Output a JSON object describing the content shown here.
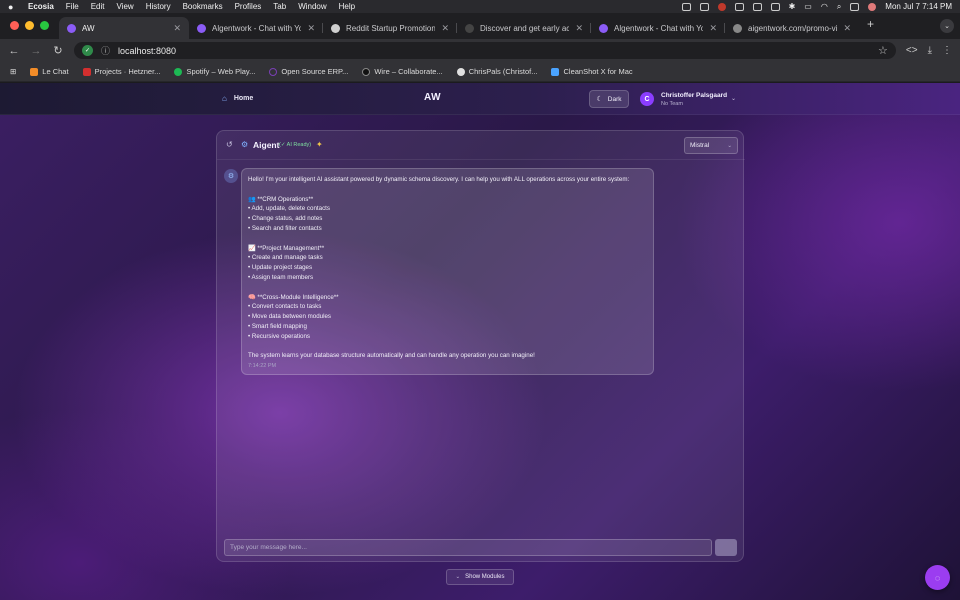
{
  "menubar": {
    "app": "Ecosia",
    "items": [
      "File",
      "Edit",
      "View",
      "History",
      "Bookmarks",
      "Profiles",
      "Tab",
      "Window",
      "Help"
    ],
    "clock": "Mon Jul 7  7:14 PM"
  },
  "tabs": [
    {
      "title": "AW",
      "active": true,
      "favicon_color": "#8b5cf6"
    },
    {
      "title": "Algentwork - Chat with Your I",
      "active": false,
      "favicon_color": "#8b5cf6"
    },
    {
      "title": "Reddit Startup Promotion Tip",
      "active": false,
      "favicon_color": "#d0d0d0"
    },
    {
      "title": "Discover and get early access",
      "active": false,
      "favicon_color": "#444"
    },
    {
      "title": "Algentwork - Chat with Your I",
      "active": false,
      "favicon_color": "#8b5cf6"
    },
    {
      "title": "aigentwork.com/promo-video",
      "active": false,
      "favicon_color": "#888"
    }
  ],
  "address": {
    "url": "localhost:8080"
  },
  "bookmarks": [
    {
      "label": "Le Chat",
      "color": "#f28c28"
    },
    {
      "label": "Projects · Hetzner...",
      "color": "#d32f2f"
    },
    {
      "label": "Spotify – Web Play...",
      "color": "#1db954"
    },
    {
      "label": "Open Source ERP...",
      "color": "#7a3fb5"
    },
    {
      "label": "Wire – Collaborate...",
      "color": "#222"
    },
    {
      "label": "ChrisPals (Christof...",
      "color": "#e0e0e0"
    },
    {
      "label": "CleanShot X for Mac",
      "color": "#4aa3ff"
    }
  ],
  "appnav": {
    "home_label": "Home",
    "brand": "AW",
    "theme_button": "Dark",
    "avatar_initial": "C",
    "user_name": "Christoffer Palsgaard",
    "team": "No Team"
  },
  "chat": {
    "title": "Aigent",
    "status": "(✓ AI Ready)",
    "model": "Mistral",
    "message_lines": [
      "Hello! I'm your intelligent AI assistant powered by dynamic schema discovery. I can help you with ALL operations across your entire system:",
      "",
      "👥 **CRM Operations**",
      "• Add, update, delete contacts",
      "• Change status, add notes",
      "• Search and filter contacts",
      "",
      "📈 **Project Management**",
      "• Create and manage tasks",
      "• Update project stages",
      "• Assign team members",
      "",
      "🧠 **Cross-Module Intelligence**",
      "• Convert contacts to tasks",
      "• Move data between modules",
      "• Smart field mapping",
      "• Recursive operations",
      "",
      "The system learns your database structure automatically and can handle any operation you can imagine!"
    ],
    "message_time": "7:14:22 PM",
    "input_placeholder": "Type your message here...",
    "modules_button": "Show Modules"
  }
}
